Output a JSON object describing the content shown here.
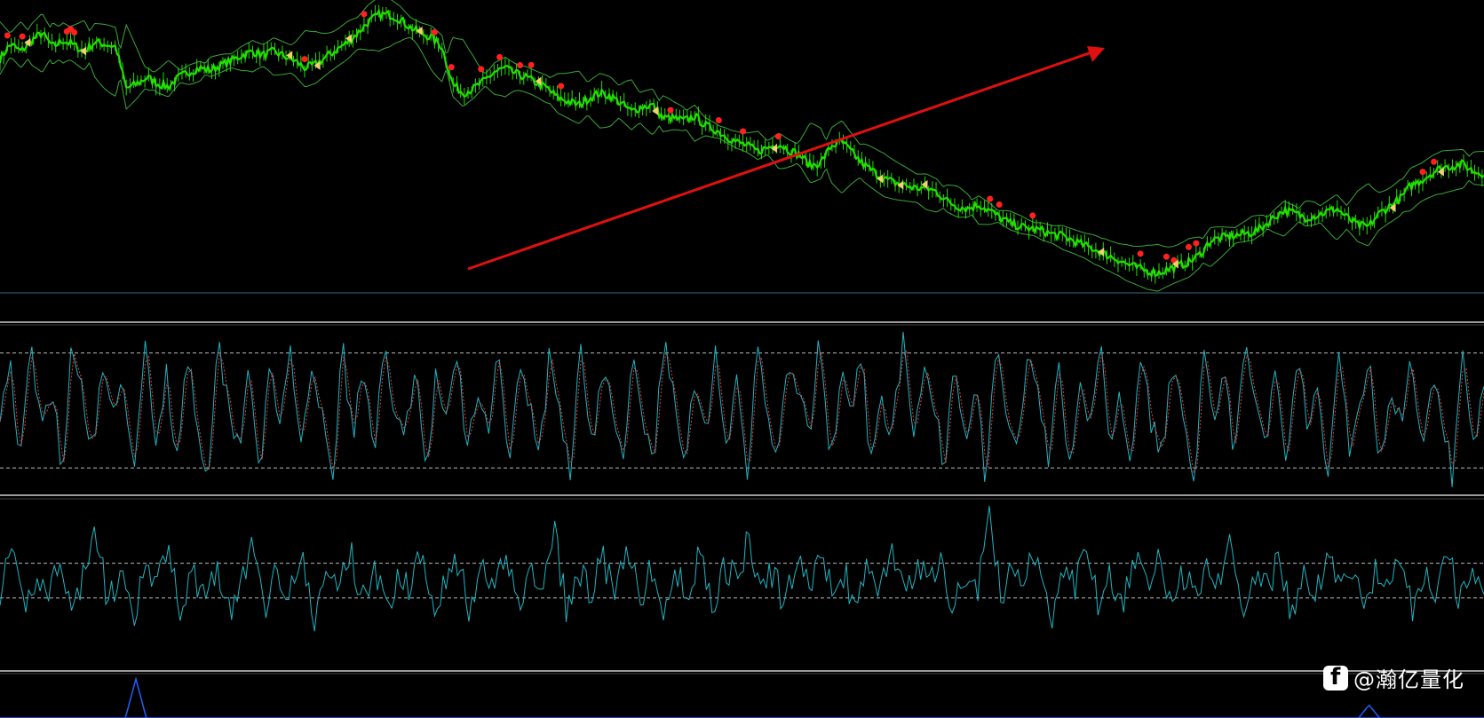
{
  "watermark": {
    "handle": "@瀚亿量化",
    "icon": "platform-logo-icon"
  },
  "colors": {
    "background": "#000000",
    "price": "#22e000",
    "bands": "#3aa83a",
    "trend_arrow": "#e01010",
    "buy_marker": "#ff2020",
    "sell_marker": "#f0d070",
    "osc_main": "#20b4c0",
    "osc_signal": "#e04040",
    "osc2": "#20b4c0",
    "vol": "#2060ff",
    "separator": "#9a9a9a",
    "levels": "#bbbbbb"
  },
  "chart_data": [
    {
      "type": "line",
      "panel": "price",
      "series": [
        {
          "values": [
            242,
            258,
            250,
            262,
            270,
            255,
            262,
            257,
            250,
            260,
            258,
            255,
            210,
            215,
            222,
            215,
            212,
            222,
            228,
            232,
            230,
            235,
            240,
            246,
            250,
            246,
            250,
            245,
            240,
            232,
            236,
            244,
            252,
            260,
            270,
            282,
            290,
            290,
            285,
            276,
            270,
            265,
            255,
            215,
            205,
            210,
            218,
            228,
            232,
            226,
            222,
            216,
            210,
            200,
            196,
            192,
            200,
            205,
            202,
            194,
            185,
            190,
            192,
            178,
            178,
            175,
            180,
            170,
            165,
            158,
            152,
            148,
            142,
            146,
            150,
            143,
            138,
            126,
            130,
            148,
            152,
            140,
            128,
            120,
            112,
            108,
            105,
            102,
            102,
            98,
            88,
            82,
            80,
            84,
            78,
            70,
            64,
            60,
            58,
            56,
            52,
            50,
            45,
            40,
            36,
            30,
            26,
            20,
            16,
            12,
            10,
            14,
            18,
            22,
            30,
            45,
            48,
            50,
            52,
            54,
            60,
            70,
            78,
            75,
            70,
            72,
            76,
            80,
            70,
            62,
            60,
            74,
            82,
            90,
            104,
            110,
            118,
            124,
            126,
            128,
            120,
            118
          ]
        }
      ],
      "overlays": [
        "bollinger-upper",
        "bollinger-lower"
      ],
      "annotations": [
        "trend-arrow"
      ],
      "markers": [
        "buy",
        "sell"
      ]
    },
    {
      "type": "line",
      "panel": "oscillator-1",
      "levels": [
        "upper-level",
        "lower-level"
      ],
      "series": [
        {
          "values": [
            52,
            78,
            18,
            88,
            35,
            70,
            12,
            95,
            60,
            25,
            82,
            40,
            68,
            8,
            90,
            30,
            75,
            20,
            85,
            45,
            10,
            92,
            55,
            28,
            80,
            15,
            72,
            38,
            94,
            22,
            66,
            48,
            6,
            88,
            33,
            77,
            18,
            96,
            50,
            26,
            84,
            12,
            70,
            42,
            90,
            20,
            62,
            36,
            98,
            8,
            74,
            54,
            24,
            86,
            44,
            14,
            92,
            32,
            68,
            58,
            10,
            82,
            40,
            22,
            94,
            52,
            16,
            76,
            36,
            88,
            28,
            64,
            4,
            90,
            48,
            20,
            80,
            60,
            30,
            96,
            14,
            70,
            46,
            84,
            12,
            56,
            38,
            92,
            24,
            74,
            50,
            18,
            86,
            34,
            66,
            8,
            94,
            42,
            28,
            78,
            58,
            20,
            90,
            12,
            72,
            46,
            88,
            32,
            62,
            16,
            96,
            40,
            24,
            80,
            54,
            6,
            84,
            36,
            70,
            22,
            92,
            48,
            30,
            76,
            18,
            88,
            44,
            64,
            10,
            94,
            26,
            58,
            82,
            14,
            68,
            40,
            90,
            20,
            74,
            50,
            6,
            86,
            34,
            62
          ]
        }
      ]
    },
    {
      "type": "line",
      "panel": "oscillator-2",
      "levels": [
        "upper-level",
        "lower-level"
      ],
      "series": [
        {
          "values": [
            45,
            65,
            30,
            55,
            40,
            70,
            25,
            60,
            80,
            35,
            55,
            20,
            60,
            45,
            75,
            30,
            55,
            40,
            62,
            28,
            50,
            72,
            35,
            58,
            44,
            66,
            22,
            54,
            48,
            70,
            38,
            60,
            30,
            56,
            46,
            74,
            34,
            52,
            62,
            26,
            58,
            42,
            68,
            36,
            54,
            48,
            80,
            30,
            56,
            44,
            64,
            40,
            70,
            38,
            58,
            28,
            52,
            46,
            66,
            34,
            60,
            50,
            76,
            42,
            56,
            36,
            62,
            48,
            70,
            40,
            54,
            32,
            60,
            46,
            72,
            38,
            58,
            50,
            66,
            30,
            56,
            44,
            92,
            40,
            62,
            52,
            70,
            20,
            54,
            46,
            68,
            38,
            58,
            30,
            64,
            48,
            72,
            36,
            56,
            42,
            60,
            50,
            74,
            34,
            58,
            44,
            66,
            28,
            52,
            40,
            70,
            46,
            60,
            38,
            56,
            50,
            64,
            32,
            58,
            42,
            68,
            36,
            54,
            48
          ]
        }
      ]
    },
    {
      "type": "area",
      "panel": "volume",
      "series": [
        {
          "values": [
            0,
            0,
            0,
            0,
            0,
            0,
            0,
            0,
            0,
            0,
            0,
            0,
            0,
            3,
            0,
            0,
            0,
            0,
            0,
            0,
            0,
            0,
            0,
            0,
            0,
            0,
            0,
            0,
            0,
            0,
            0,
            0,
            0,
            0,
            0,
            0,
            0,
            0,
            0,
            0,
            0,
            0,
            0,
            0,
            0,
            0,
            0,
            0,
            0,
            0,
            0,
            0,
            0,
            0,
            0,
            0,
            0,
            0,
            0,
            0,
            0,
            0,
            0,
            0,
            0,
            0,
            0,
            0,
            0,
            0,
            0,
            0,
            0,
            0,
            0,
            0,
            0,
            0,
            0,
            0,
            0,
            0,
            0,
            0,
            0,
            0,
            0,
            0,
            0,
            0,
            0,
            0,
            0,
            0,
            0,
            0,
            0,
            0,
            0,
            0,
            0,
            0,
            0,
            0,
            0,
            0,
            0,
            0,
            0,
            0,
            0,
            0,
            0,
            0,
            0,
            0,
            0,
            0,
            0,
            0,
            0,
            0,
            0,
            0,
            0,
            0,
            0,
            0,
            0,
            0,
            0,
            1,
            0,
            0,
            0,
            0,
            0,
            0,
            0,
            0,
            0,
            0,
            0
          ]
        }
      ]
    }
  ]
}
